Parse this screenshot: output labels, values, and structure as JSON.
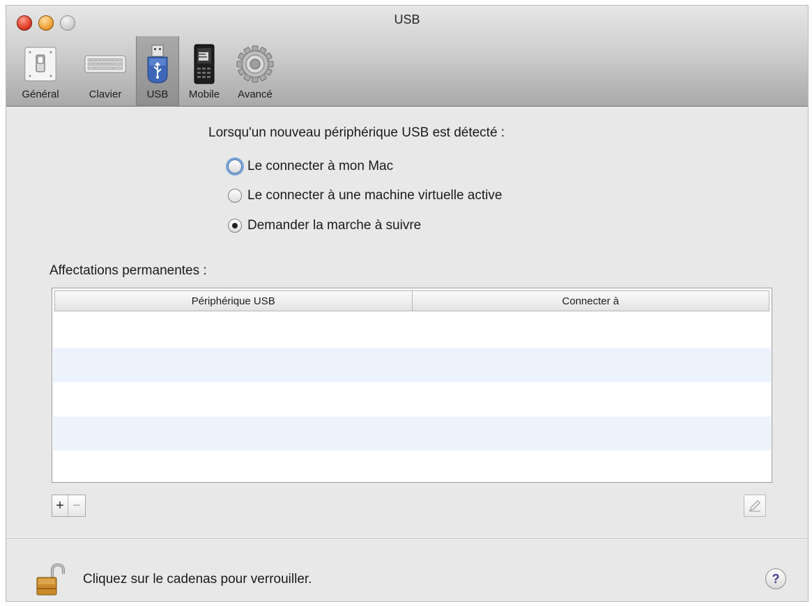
{
  "window": {
    "title": "USB"
  },
  "toolbar": {
    "items": [
      {
        "label": "Général",
        "icon": "general-switch-icon",
        "selected": false
      },
      {
        "label": "Clavier",
        "icon": "keyboard-icon",
        "selected": false
      },
      {
        "label": "USB",
        "icon": "usb-drive-icon",
        "selected": true
      },
      {
        "label": "Mobile",
        "icon": "mobile-phone-icon",
        "selected": false
      },
      {
        "label": "Avancé",
        "icon": "gear-icon",
        "selected": false
      }
    ]
  },
  "usb_prompt": {
    "label": "Lorsqu'un nouveau périphérique USB est détecté :",
    "options": [
      {
        "label": "Le connecter à mon Mac",
        "selected": false,
        "focused": true
      },
      {
        "label": "Le connecter à une machine virtuelle active",
        "selected": false,
        "focused": false
      },
      {
        "label": "Demander la marche à suivre",
        "selected": true,
        "focused": false
      }
    ]
  },
  "assignments": {
    "label": "Affectations permanentes :",
    "columns": [
      "Périphérique USB",
      "Connecter à"
    ],
    "rows": []
  },
  "buttons": {
    "add": "+",
    "remove": "−"
  },
  "footer": {
    "lock_text": "Cliquez sur le cadenas pour verrouiller.",
    "help": "?"
  },
  "colors": {
    "alt_row": "#edf3fd",
    "selected_tab": "#9b9b9b",
    "focus_ring": "#7aa4d8"
  }
}
